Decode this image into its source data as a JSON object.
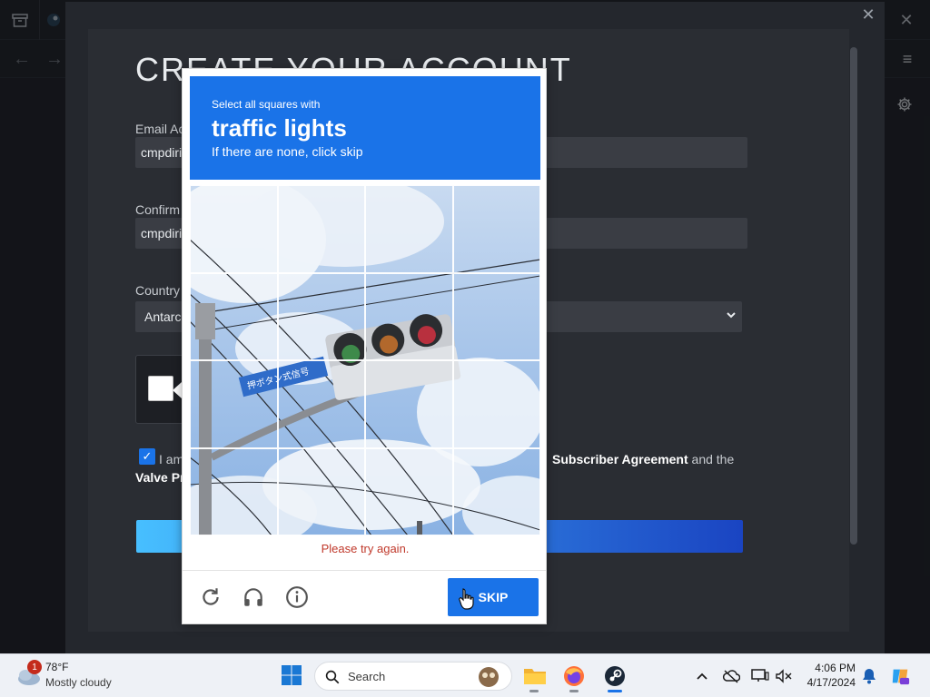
{
  "client": {
    "close_glyph": "✕",
    "back_glyph": "←",
    "forward_glyph": "→",
    "menu_glyph": "≡"
  },
  "modal": {
    "close_glyph": "✕",
    "title": "CREATE YOUR ACCOUNT",
    "email_label": "Email Ac",
    "email_value": "cmpdiri",
    "confirm_label": "Confirm",
    "confirm_value": "cmpdiri",
    "country_label": "Country",
    "country_value": "Antarc",
    "agree_prefix": "I am",
    "agree_subscriber": "Subscriber Agreement",
    "agree_and_the": "and the",
    "agree_valve": "Valve Pr"
  },
  "captcha": {
    "prompt_small": "Select all squares with",
    "prompt_target": "traffic lights",
    "prompt_hint": "If there are none, click skip",
    "error": "Please try again.",
    "skip_label": "SKIP",
    "icons": [
      "refresh-icon",
      "headphones-icon",
      "info-icon"
    ],
    "sign_text": "押ボタン式信号"
  },
  "taskbar": {
    "weather_temp": "78°F",
    "weather_cond": "Mostly cloudy",
    "weather_badge": "1",
    "search_label": "Search",
    "time": "4:06 PM",
    "date": "4/17/2024",
    "apps": [
      "file-explorer-icon",
      "firefox-icon",
      "steam-icon"
    ]
  },
  "colors": {
    "accent": "#1a73e8",
    "error": "#c0392b",
    "modal_bg": "#24272d",
    "field_bg": "#3a3d44"
  }
}
